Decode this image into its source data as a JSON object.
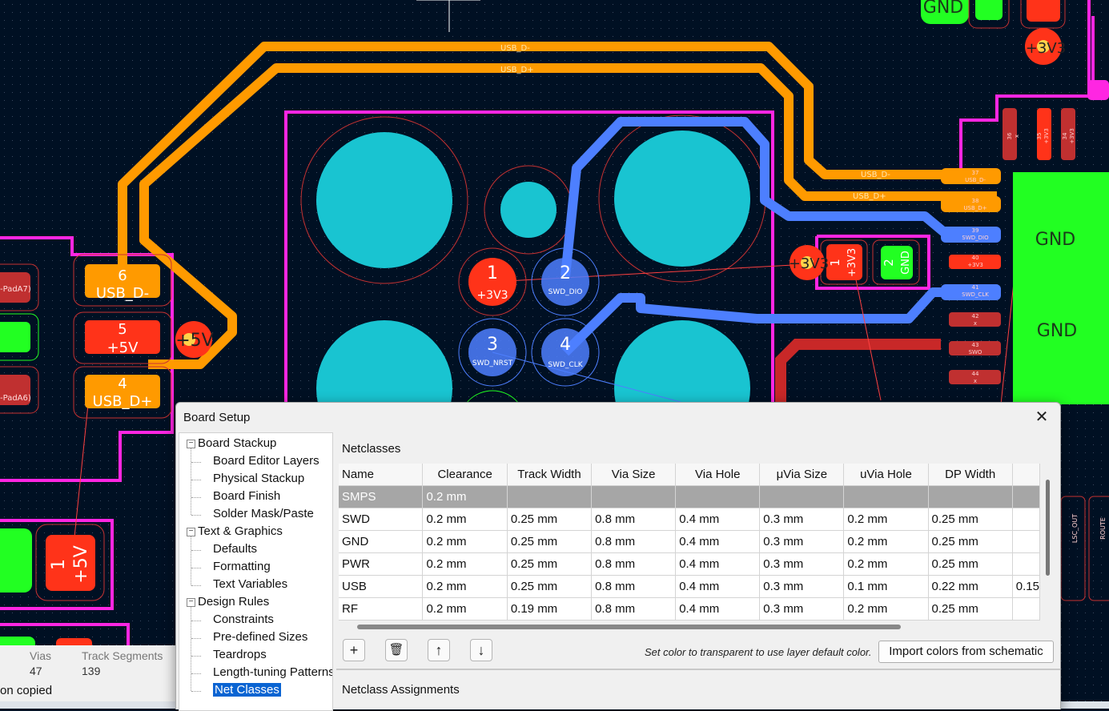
{
  "pcb": {
    "traces": {
      "usb_dm": "USB_D-",
      "usb_dp": "USB_D+"
    },
    "pads": [
      {
        "num": "1",
        "net": "+3V3"
      },
      {
        "num": "2",
        "net": "SWD_DIO"
      },
      {
        "num": "3",
        "net": "SWD_NRST"
      },
      {
        "num": "4",
        "net": "SWD_CLK"
      }
    ],
    "connector": [
      {
        "num": "6",
        "net": "USB_D-"
      },
      {
        "num": "5",
        "net": "+5V"
      },
      {
        "num": "4",
        "net": "USB_D+"
      }
    ],
    "power_labels": {
      "v5": "+5V",
      "v3": "+3V3",
      "gnd": "GND"
    },
    "cap": {
      "pad1": "1",
      "pad1_net": "+3V3",
      "pad2": "2",
      "pad2_net": "GND"
    },
    "ic_pins": [
      {
        "num": "37",
        "net": "USB_D-"
      },
      {
        "num": "38",
        "net": "USB_D+"
      },
      {
        "num": "39",
        "net": "SWD_DIO"
      },
      {
        "num": "40",
        "net": "+3V3"
      },
      {
        "num": "41",
        "net": "SWD_CLK"
      },
      {
        "num": "42",
        "net": "x"
      },
      {
        "num": "43",
        "net": "SWO"
      },
      {
        "num": "44",
        "net": "x"
      }
    ],
    "ic_top_pins": [
      {
        "num": "36",
        "net": "x"
      },
      {
        "num": "35",
        "net": "+3V3"
      },
      {
        "num": "34",
        "net": "+3V3"
      }
    ],
    "left_pads": {
      "a": "-PadA7)",
      "b": "-PadA6)"
    },
    "left_big": {
      "num": "1",
      "net": "+5V"
    },
    "right_labels": {
      "lsc": "LSC_OUT",
      "route": "ROUTE"
    }
  },
  "status": {
    "vias_label": "Vias",
    "vias_value": "47",
    "segments_label": "Track Segments",
    "segments_value": "139",
    "message": "on copied"
  },
  "dialog": {
    "title": "Board Setup",
    "close_glyph": "✕",
    "tree": [
      {
        "label": "Board Stackup",
        "level": 0
      },
      {
        "label": "Board Editor Layers",
        "level": 1
      },
      {
        "label": "Physical Stackup",
        "level": 1
      },
      {
        "label": "Board Finish",
        "level": 1
      },
      {
        "label": "Solder Mask/Paste",
        "level": 1
      },
      {
        "label": "Text & Graphics",
        "level": 0
      },
      {
        "label": "Defaults",
        "level": 1
      },
      {
        "label": "Formatting",
        "level": 1
      },
      {
        "label": "Text Variables",
        "level": 1
      },
      {
        "label": "Design Rules",
        "level": 0
      },
      {
        "label": "Constraints",
        "level": 1
      },
      {
        "label": "Pre-defined Sizes",
        "level": 1
      },
      {
        "label": "Teardrops",
        "level": 1
      },
      {
        "label": "Length-tuning Patterns",
        "level": 1
      },
      {
        "label": "Net Classes",
        "level": 1,
        "selected": true
      }
    ],
    "netclasses_title": "Netclasses",
    "columns": [
      "Name",
      "Clearance",
      "Track Width",
      "Via Size",
      "Via Hole",
      "μVia Size",
      "uVia Hole",
      "DP Width",
      ""
    ],
    "rows": [
      [
        "SMPS",
        "0.2 mm",
        "",
        "",
        "",
        "",
        "",
        "",
        ""
      ],
      [
        "SWD",
        "0.2 mm",
        "0.25 mm",
        "0.8 mm",
        "0.4 mm",
        "0.3 mm",
        "0.2 mm",
        "0.25 mm",
        ""
      ],
      [
        "GND",
        "0.2 mm",
        "0.25 mm",
        "0.8 mm",
        "0.4 mm",
        "0.3 mm",
        "0.2 mm",
        "0.25 mm",
        ""
      ],
      [
        "PWR",
        "0.2 mm",
        "0.25 mm",
        "0.8 mm",
        "0.4 mm",
        "0.3 mm",
        "0.2 mm",
        "0.25 mm",
        ""
      ],
      [
        "USB",
        "0.2 mm",
        "0.25 mm",
        "0.8 mm",
        "0.4 mm",
        "0.3 mm",
        "0.1 mm",
        "0.22 mm",
        "0.15"
      ],
      [
        "RF",
        "0.2 mm",
        "0.19 mm",
        "0.8 mm",
        "0.4 mm",
        "0.3 mm",
        "0.2 mm",
        "0.25 mm",
        ""
      ]
    ],
    "buttons": {
      "add": "+",
      "delete": "🗑",
      "up": "↑",
      "down": "↓"
    },
    "hint": "Set color to transparent to use layer default color.",
    "import_label": "Import colors from schematic",
    "assignments_title": "Netclass Assignments"
  },
  "colors": {
    "background": "#001023",
    "front_copper": "#ff3319",
    "back_copper": "#4d7fff",
    "edge_magenta": "#ff26e2",
    "orange_trace": "#ff9a00",
    "gnd_green": "#22ff22",
    "hole_cyan": "#19c4d1",
    "selection_blue": "#0a64d2"
  }
}
